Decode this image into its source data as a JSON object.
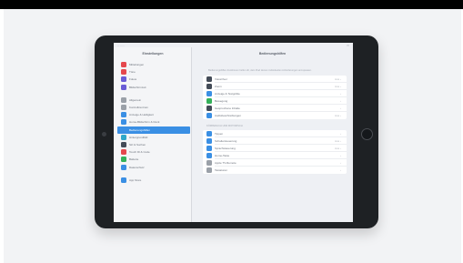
{
  "settings": {
    "sidebar_title": "Einstellungen",
    "sidebar_groups": [
      [
        {
          "label": "Mitteilungen",
          "color": "#e5484d"
        },
        {
          "label": "Töne",
          "color": "#e5484d"
        },
        {
          "label": "Fokus",
          "color": "#6a5cd6"
        },
        {
          "label": "Bildschirmzeit",
          "color": "#6a5cd6"
        }
      ],
      [
        {
          "label": "Allgemein",
          "color": "#9aa0a8"
        },
        {
          "label": "Kontrollzentrum",
          "color": "#9aa0a8"
        },
        {
          "label": "Anzeige & Helligkeit",
          "color": "#3a8fe4"
        },
        {
          "label": "Home-Bildschirm & Dock",
          "color": "#3a8fe4"
        },
        {
          "label": "Bedienungshilfen",
          "color": "#3a8fe4",
          "active": true
        },
        {
          "label": "Hintergrundbild",
          "color": "#2fa7c9"
        },
        {
          "label": "Siri & Suchen",
          "color": "#444c58"
        },
        {
          "label": "Touch ID & Code",
          "color": "#e5484d"
        },
        {
          "label": "Batterie",
          "color": "#34b15a"
        },
        {
          "label": "Datenschutz",
          "color": "#3a8fe4"
        }
      ],
      [
        {
          "label": "App Store",
          "color": "#3a8fe4"
        }
      ]
    ],
    "detail": {
      "title": "Bedienungshilfen",
      "description": "Bedienungshilfen-Funktionen helfen dir, dein iPad deinen individuellen Anforderungen anzupassen.",
      "vision_rows": [
        {
          "label": "VoiceOver",
          "value": "Aus",
          "color": "#444c58"
        },
        {
          "label": "Zoom",
          "value": "Aus",
          "color": "#444c58"
        },
        {
          "label": "Anzeige & Textgröße",
          "value": "",
          "color": "#3a8fe4"
        },
        {
          "label": "Bewegung",
          "value": "",
          "color": "#34b15a"
        },
        {
          "label": "Gesprochene Inhalte",
          "value": "",
          "color": "#444c58"
        },
        {
          "label": "Audiobeschreibungen",
          "value": "Aus",
          "color": "#3a8fe4"
        }
      ],
      "physical_header": "KÖRPERLICH UND MOTORISCH",
      "physical_rows": [
        {
          "label": "Tippen",
          "value": "",
          "color": "#3a8fe4"
        },
        {
          "label": "Schaltersteuerung",
          "value": "Aus",
          "color": "#3a8fe4"
        },
        {
          "label": "Sprachsteuerung",
          "value": "Aus",
          "color": "#3a8fe4"
        },
        {
          "label": "Home-Taste",
          "value": "",
          "color": "#3a8fe4"
        },
        {
          "label": "Apple TV-Remote",
          "value": "",
          "color": "#9aa0a8"
        },
        {
          "label": "Tastaturen",
          "value": "",
          "color": "#9aa0a8"
        }
      ]
    }
  }
}
